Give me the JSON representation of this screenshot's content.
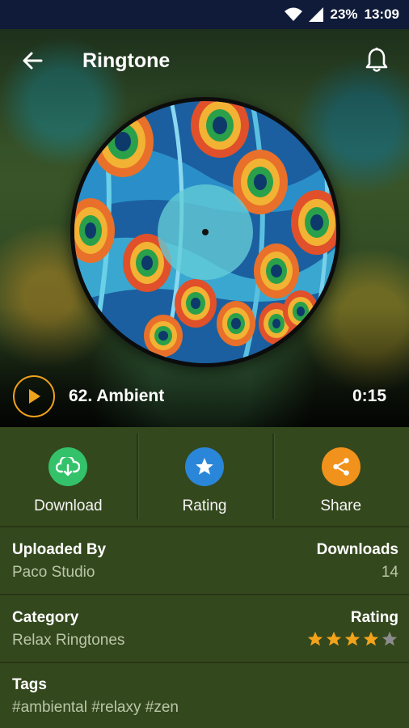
{
  "status_bar": {
    "battery": "23%",
    "time": "13:09"
  },
  "toolbar": {
    "title": "Ringtone"
  },
  "player": {
    "track_name": "62. Ambient",
    "duration": "0:15"
  },
  "actions": [
    {
      "label": "Download",
      "icon": "cloud-download-icon",
      "color": "#33c26a"
    },
    {
      "label": "Rating",
      "icon": "star-icon",
      "color": "#2a86d8"
    },
    {
      "label": "Share",
      "icon": "share-icon",
      "color": "#f1921c"
    }
  ],
  "details": {
    "uploaded_by_label": "Uploaded By",
    "uploaded_by_value": "Paco Studio",
    "downloads_label": "Downloads",
    "downloads_value": "14",
    "category_label": "Category",
    "category_value": "Relax Ringtones",
    "rating_label": "Rating",
    "rating_value": 4,
    "rating_max": 5,
    "tags_label": "Tags",
    "tags_value": "#ambiental #relaxy #zen"
  },
  "colors": {
    "background": "#34481d",
    "accent": "#f0a21c",
    "star_filled": "#f2a31b",
    "star_empty": "#8c8c8c"
  }
}
